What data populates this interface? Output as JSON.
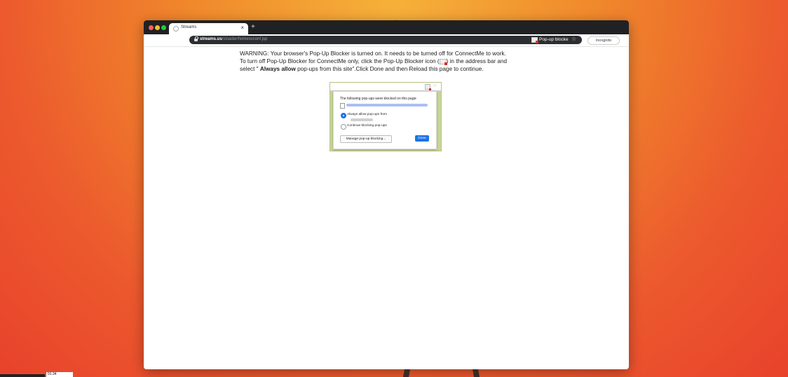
{
  "browser": {
    "tab_title": "Streams",
    "tab_close": "×",
    "new_tab": "+",
    "url_host": "streams.us",
    "url_path": "/sloader/homesvconf.jsp",
    "popup_blocked_label": "Pop-up blocke",
    "bookmark_star": "☆",
    "incognito_label": "Incognito"
  },
  "page": {
    "warning_line1": "WARNING: Your browser's Pop-Up Blocker is turned on. It needs to be turned off for ConnectMe to work.",
    "warning_line2_pre": "To turn off Pop-Up Blocker for ConnectMe only, click the Pop-Up Blocker icon (",
    "warning_line2_post": ") in the address bar and",
    "warning_line3_pre": "select \" ",
    "warning_line3_bold": "Always allow",
    "warning_line3_post": " pop-ups from this site\".Click Done and then Reload this page to continue."
  },
  "dialog": {
    "heading": "The following pop-ups were blocked on this page:",
    "option_allow": "Always allow pop-ups from",
    "option_block": "Continue blocking pop-ups",
    "manage_button": "Manage pop-up blocking...",
    "done_button": "Done"
  },
  "player": {
    "time": "01:34"
  },
  "colors": {
    "accent": "#1a73e8",
    "titlebar": "#202124",
    "omnibox": "#2d2e31"
  }
}
